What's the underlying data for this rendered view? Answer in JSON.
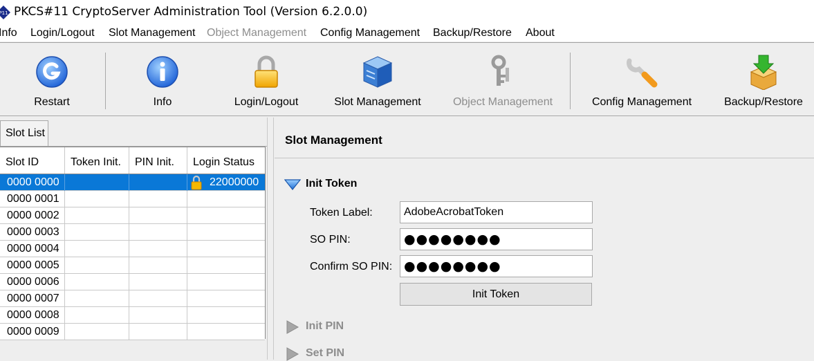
{
  "window": {
    "title": "PKCS#11 CryptoServer Administration Tool (Version 6.2.0.0)",
    "app_icon_text": "P11"
  },
  "menu": [
    {
      "label": "Info",
      "enabled": true
    },
    {
      "label": "Login/Logout",
      "enabled": true
    },
    {
      "label": "Slot Management",
      "enabled": true
    },
    {
      "label": "Object Management",
      "enabled": false
    },
    {
      "label": "Config Management",
      "enabled": true
    },
    {
      "label": "Backup/Restore",
      "enabled": true
    },
    {
      "label": "About",
      "enabled": true
    }
  ],
  "toolbar": [
    {
      "label": "Restart",
      "icon": "restart-icon",
      "enabled": true
    },
    {
      "label": "Info",
      "icon": "info-icon",
      "enabled": true
    },
    {
      "label": "Login/Logout",
      "icon": "padlock-icon",
      "enabled": true
    },
    {
      "label": "Slot Management",
      "icon": "server-cube-icon",
      "enabled": true
    },
    {
      "label": "Object Management",
      "icon": "keys-icon",
      "enabled": false
    },
    {
      "label": "Config Management",
      "icon": "wrench-icon",
      "enabled": true
    },
    {
      "label": "Backup/Restore",
      "icon": "box-arrow-icon",
      "enabled": true
    }
  ],
  "slot_list": {
    "tab_label": "Slot List",
    "columns": [
      "Slot ID",
      "Token Init.",
      "PIN Init.",
      "Login Status"
    ],
    "rows": [
      {
        "slot_id": "0000 0000",
        "token_init": "",
        "pin_init": "",
        "login_status": "22000000",
        "locked": true,
        "selected": true
      },
      {
        "slot_id": "0000 0001",
        "token_init": "",
        "pin_init": "",
        "login_status": ""
      },
      {
        "slot_id": "0000 0002",
        "token_init": "",
        "pin_init": "",
        "login_status": ""
      },
      {
        "slot_id": "0000 0003",
        "token_init": "",
        "pin_init": "",
        "login_status": ""
      },
      {
        "slot_id": "0000 0004",
        "token_init": "",
        "pin_init": "",
        "login_status": ""
      },
      {
        "slot_id": "0000 0005",
        "token_init": "",
        "pin_init": "",
        "login_status": ""
      },
      {
        "slot_id": "0000 0006",
        "token_init": "",
        "pin_init": "",
        "login_status": ""
      },
      {
        "slot_id": "0000 0007",
        "token_init": "",
        "pin_init": "",
        "login_status": ""
      },
      {
        "slot_id": "0000 0008",
        "token_init": "",
        "pin_init": "",
        "login_status": ""
      },
      {
        "slot_id": "0000 0009",
        "token_init": "",
        "pin_init": "",
        "login_status": ""
      }
    ]
  },
  "slot_management": {
    "title": "Slot Management",
    "init_token": {
      "section_label": "Init Token",
      "token_label_label": "Token Label:",
      "token_label_value": "AdobeAcrobatToken",
      "so_pin_label": "SO PIN:",
      "so_pin_value": "●●●●●●●●",
      "confirm_so_pin_label": "Confirm SO PIN:",
      "confirm_so_pin_value": "●●●●●●●●",
      "button_label": "Init Token"
    },
    "init_pin": {
      "section_label": "Init PIN",
      "enabled": false
    },
    "set_pin": {
      "section_label": "Set PIN",
      "enabled": false
    }
  },
  "colors": {
    "selection": "#0a78d7",
    "disabled_text": "#8d8d8d",
    "panel_bg": "#eeeeee"
  }
}
